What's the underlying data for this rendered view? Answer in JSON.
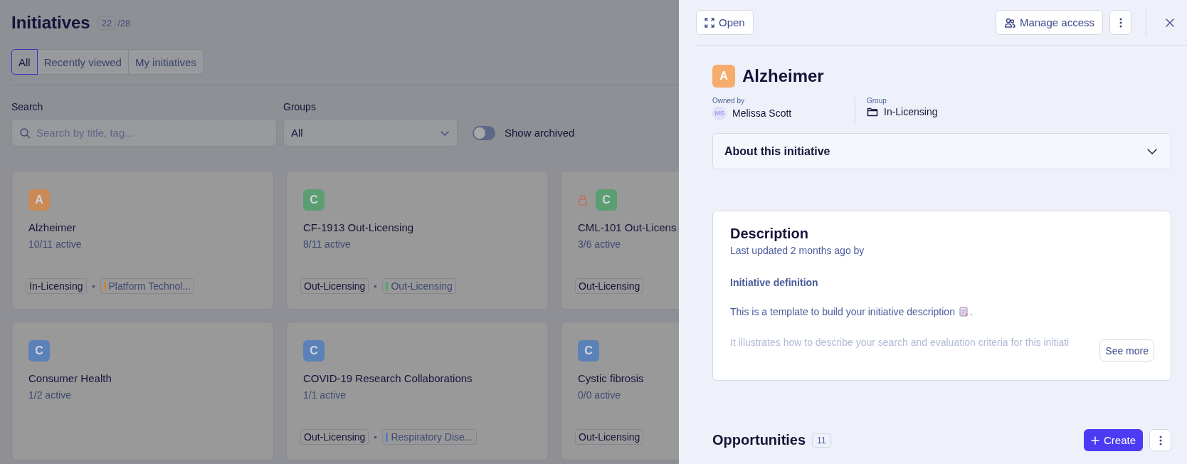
{
  "page": {
    "title": "Initiatives",
    "count": "22",
    "total": "/28",
    "tabs": [
      {
        "label": "All",
        "selected": true
      },
      {
        "label": "Recently viewed",
        "selected": false
      },
      {
        "label": "My initiatives",
        "selected": false
      }
    ],
    "search": {
      "label": "Search",
      "placeholder": "Search by title, tag..."
    },
    "groups": {
      "label": "Groups",
      "value": "All"
    },
    "show_archived": {
      "label": "Show archived",
      "on": false
    },
    "cards": [
      {
        "letter": "A",
        "color": "#c98a55",
        "locked": false,
        "title": "Alzheimer",
        "active": "10/11 active",
        "tags": [
          {
            "label": "In-Licensing"
          },
          {
            "label": "Platform Technol...",
            "color": "#d0843e"
          }
        ]
      },
      {
        "letter": "C",
        "color": "#5a9e72",
        "locked": false,
        "title": "CF-1913 Out-Licensing",
        "active": "8/11 active",
        "tags": [
          {
            "label": "Out-Licensing"
          },
          {
            "label": "Out-Licensing",
            "color": "#4fa86a"
          }
        ]
      },
      {
        "letter": "C",
        "color": "#5a9e72",
        "locked": true,
        "title": "CML-101 Out-Licens",
        "active": "3/6 active",
        "tags": [
          {
            "label": "Out-Licensing"
          }
        ]
      },
      {
        "letter": "C",
        "color": "#5b82b8",
        "locked": false,
        "title": "Consumer Health",
        "active": "1/2 active"
      },
      {
        "letter": "C",
        "color": "#5b82b8",
        "locked": false,
        "title": "COVID-19 Research Collaborations",
        "active": "1/1 active",
        "tags": [
          {
            "label": "Out-Licensing"
          },
          {
            "label": "Respiratory Dise...",
            "color": "#5b7fc0"
          }
        ]
      },
      {
        "letter": "C",
        "color": "#5b82b8",
        "locked": false,
        "title": "Cystic fibrosis",
        "active": "0/0 active",
        "tags": [
          {
            "label": "Out-Licensing"
          }
        ]
      }
    ]
  },
  "panel": {
    "open_button": "Open",
    "manage_access_button": "Manage access",
    "letter": "A",
    "color": "#f6ac6c",
    "title": "Alzheimer",
    "owner": {
      "label": "Owned by",
      "initials": "MS",
      "name": "Melissa Scott"
    },
    "group": {
      "label": "Group",
      "name": "In-Licensing"
    },
    "about": {
      "label": "About this initiative",
      "expanded": false
    },
    "description": {
      "title": "Description",
      "updated": "Last updated 2 months ago by",
      "heading": "Initiative definition",
      "intro": "This is a template to build your initiative description",
      "intro_end": ".",
      "faded": "It illustrates how to describe your search and evaluation criteria for this initiati",
      "see_more": "See more"
    },
    "opportunities": {
      "title": "Opportunities",
      "count": "11",
      "create_button": "Create"
    }
  }
}
